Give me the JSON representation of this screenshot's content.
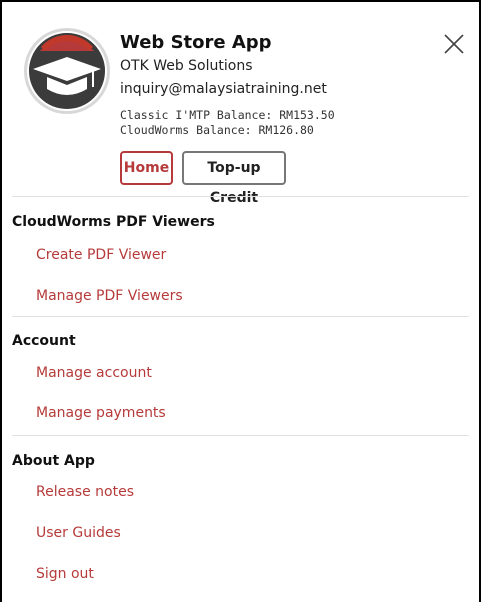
{
  "header": {
    "app_title": "Web Store App",
    "company": "OTK Web Solutions",
    "email": "inquiry@malaysiatraining.net",
    "balance_classic": "Classic I'MTP Balance: RM153.50",
    "balance_cloudworms": "CloudWorms Balance: RM126.80",
    "home_label": "Home",
    "topup_label": "Top-up Credit"
  },
  "sections": {
    "pdf": {
      "title": "CloudWorms PDF Viewers",
      "items": [
        "Create PDF Viewer",
        "Manage PDF Viewers"
      ]
    },
    "account": {
      "title": "Account",
      "items": [
        "Manage account",
        "Manage payments"
      ]
    },
    "about": {
      "title": "About App",
      "items": [
        "Release notes",
        "User Guides",
        "Sign out"
      ]
    }
  },
  "colors": {
    "accent": "#b63a3a",
    "divider": "#e2e2e2",
    "text": "#111111"
  },
  "icons": {
    "avatar": "graduation-cap-icon",
    "close": "close-icon"
  }
}
